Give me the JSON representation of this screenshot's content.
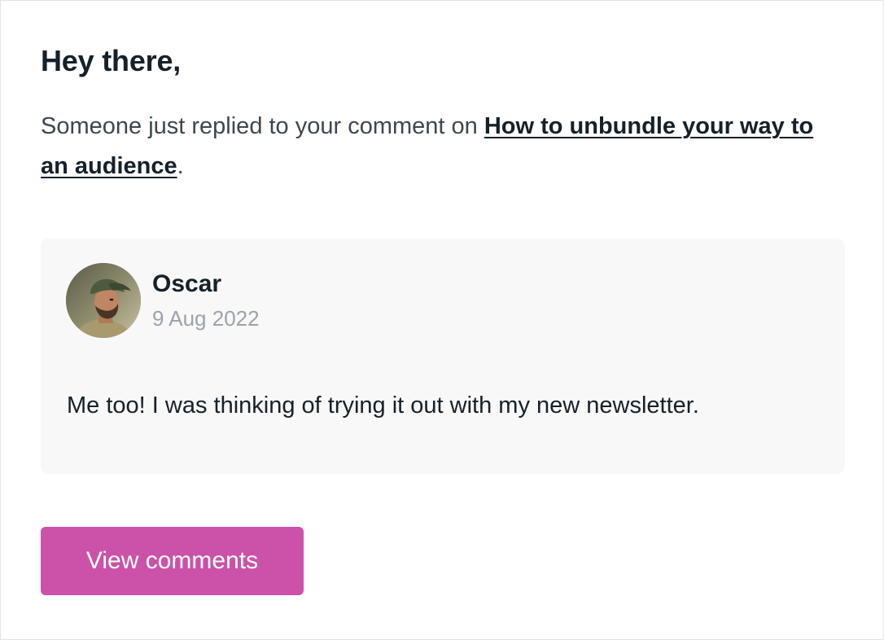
{
  "email": {
    "greeting": "Hey there,",
    "intro_prefix": "Someone just replied to your comment on ",
    "post_title": "How to unbundle your way to an audience",
    "intro_suffix": "."
  },
  "comment": {
    "author": "Oscar",
    "date": "9 Aug 2022",
    "text": "Me too! I was thinking of trying it out with my new newsletter.",
    "avatar_icon": "user-photo-avatar"
  },
  "cta": {
    "label": "View comments"
  },
  "colors": {
    "accent": "#cb52a8",
    "text_primary": "#15212a",
    "text_secondary": "#3d4750",
    "muted": "#9aa3ab",
    "card_bg": "#f8f8f8",
    "border": "#e3e3e3"
  }
}
